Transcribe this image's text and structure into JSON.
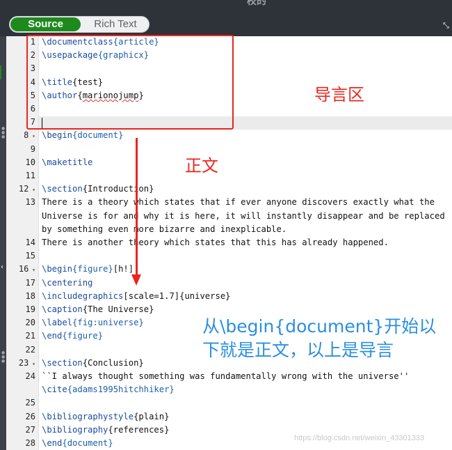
{
  "header": {
    "title": "校的"
  },
  "toggle": {
    "source_label": "Source",
    "rich_label": "Rich Text"
  },
  "gutter": [
    "1",
    "2",
    "3",
    "4",
    "5",
    "6",
    "7",
    "8",
    "9",
    "10",
    "11",
    "12",
    "13",
    "",
    "",
    "14",
    "15",
    "16",
    "17",
    "18",
    "19",
    "20",
    "21",
    "22",
    "23",
    "24",
    "",
    "25",
    "26",
    "27",
    "28"
  ],
  "code_lines": [
    [
      {
        "t": "\\documentclass",
        "c": "kw"
      },
      {
        "t": "{article}",
        "c": "arg"
      }
    ],
    [
      {
        "t": "\\usepackage",
        "c": "kw"
      },
      {
        "t": "{graphicx}",
        "c": "arg"
      }
    ],
    [],
    [
      {
        "t": "\\title",
        "c": "kw"
      },
      {
        "t": "{test}",
        "c": ""
      }
    ],
    [
      {
        "t": "\\author",
        "c": "kw"
      },
      {
        "t": "{",
        "c": ""
      },
      {
        "t": "marionojump",
        "c": "squig"
      },
      {
        "t": "}",
        "c": ""
      }
    ],
    [],
    [],
    [
      {
        "t": "\\begin",
        "c": "kw"
      },
      {
        "t": "{document}",
        "c": "arg"
      }
    ],
    [],
    [
      {
        "t": "\\maketitle",
        "c": "kw"
      }
    ],
    [],
    [
      {
        "t": "\\section",
        "c": "kw"
      },
      {
        "t": "{Introduction}",
        "c": ""
      }
    ],
    [
      {
        "t": "There is a theory which states that if ever anyone discovers exactly what the",
        "c": ""
      }
    ],
    [
      {
        "t": "Universe is for and why it is here, it will instantly disappear and be replaced",
        "c": ""
      }
    ],
    [
      {
        "t": "by something even more bizarre and inexplicable.",
        "c": ""
      }
    ],
    [
      {
        "t": "There is another theory which states that this has already happened.",
        "c": ""
      }
    ],
    [],
    [
      {
        "t": "\\begin",
        "c": "kw"
      },
      {
        "t": "{figure}",
        "c": "arg"
      },
      {
        "t": "[h!]",
        "c": ""
      }
    ],
    [
      {
        "t": "\\centering",
        "c": "kw"
      }
    ],
    [
      {
        "t": "\\includegraphics",
        "c": "kw"
      },
      {
        "t": "[scale=1.7]{universe}",
        "c": ""
      }
    ],
    [
      {
        "t": "\\caption",
        "c": "kw"
      },
      {
        "t": "{The Universe}",
        "c": ""
      }
    ],
    [
      {
        "t": "\\label",
        "c": "kw"
      },
      {
        "t": "{fig:universe}",
        "c": "arg"
      }
    ],
    [
      {
        "t": "\\end",
        "c": "kw"
      },
      {
        "t": "{figure}",
        "c": "arg"
      }
    ],
    [],
    [
      {
        "t": "\\section",
        "c": "kw"
      },
      {
        "t": "{Conclusion}",
        "c": ""
      }
    ],
    [
      {
        "t": "``I always thought something was fundamentally wrong with the universe''",
        "c": ""
      }
    ],
    [
      {
        "t": "\\cite",
        "c": "kw"
      },
      {
        "t": "{adams1995hitchhiker}",
        "c": "arg"
      }
    ],
    [],
    [
      {
        "t": "\\bibliographystyle",
        "c": "kw"
      },
      {
        "t": "{plain}",
        "c": ""
      }
    ],
    [
      {
        "t": "\\bibliography",
        "c": "kw"
      },
      {
        "t": "{references}",
        "c": ""
      }
    ],
    [
      {
        "t": "\\end",
        "c": "kw"
      },
      {
        "t": "{document}",
        "c": "arg"
      }
    ]
  ],
  "fold_lines": [
    "8",
    "12",
    "16",
    "23"
  ],
  "annotations": {
    "preamble": "导言区",
    "body": "正文",
    "description": "从\\begin{document}开始以下就是正文，以上是导言"
  },
  "watermark": "https://blog.csdn.net/weixin_43301333",
  "colors": {
    "accent_green": "#1e8a1e",
    "annotation_red": "#e8261e",
    "annotation_blue": "#2a8fe0",
    "keyword": "#1b4a9c"
  },
  "icons": {
    "expand": "expand-icon",
    "collapse": "chevron-left-icon",
    "fold": "fold-triangle-icon"
  }
}
